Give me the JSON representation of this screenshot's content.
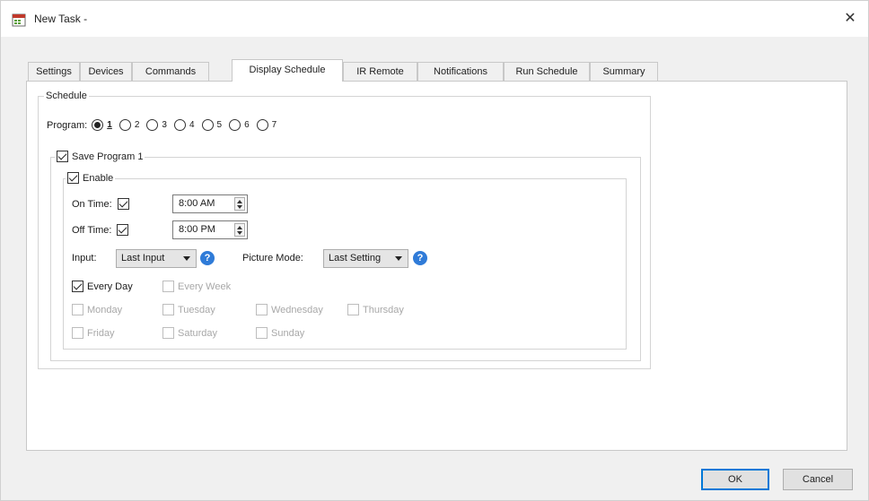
{
  "window": {
    "title": "New Task -",
    "close_glyph": "✕"
  },
  "tabs": [
    {
      "label": "Settings"
    },
    {
      "label": "Devices"
    },
    {
      "label": "Commands"
    },
    {
      "label": "Display Schedule",
      "active": true
    },
    {
      "label": "IR Remote"
    },
    {
      "label": "Notifications"
    },
    {
      "label": "Run Schedule"
    },
    {
      "label": "Summary"
    }
  ],
  "schedule": {
    "group_label": "Schedule",
    "program_label": "Program:",
    "programs": [
      "1",
      "2",
      "3",
      "4",
      "5",
      "6",
      "7"
    ],
    "selected_program": "1",
    "save_program": {
      "label": "Save Program 1",
      "checked": true
    },
    "enable": {
      "label": "Enable",
      "checked": true
    },
    "on_time": {
      "label": "On Time:",
      "checked": true,
      "value": "8:00 AM"
    },
    "off_time": {
      "label": "Off Time:",
      "checked": true,
      "value": "8:00 PM"
    },
    "input": {
      "label": "Input:",
      "value": "Last Input"
    },
    "picture_mode": {
      "label": "Picture Mode:",
      "value": "Last Setting"
    },
    "help_glyph": "?",
    "every_day": {
      "label": "Every Day",
      "checked": true
    },
    "every_week": {
      "label": "Every Week",
      "checked": false
    },
    "days": {
      "monday": "Monday",
      "tuesday": "Tuesday",
      "wednesday": "Wednesday",
      "thursday": "Thursday",
      "friday": "Friday",
      "saturday": "Saturday",
      "sunday": "Sunday"
    }
  },
  "buttons": {
    "ok": "OK",
    "cancel": "Cancel"
  },
  "colors": {
    "accent": "#0078d7",
    "help": "#2f7bd8"
  }
}
